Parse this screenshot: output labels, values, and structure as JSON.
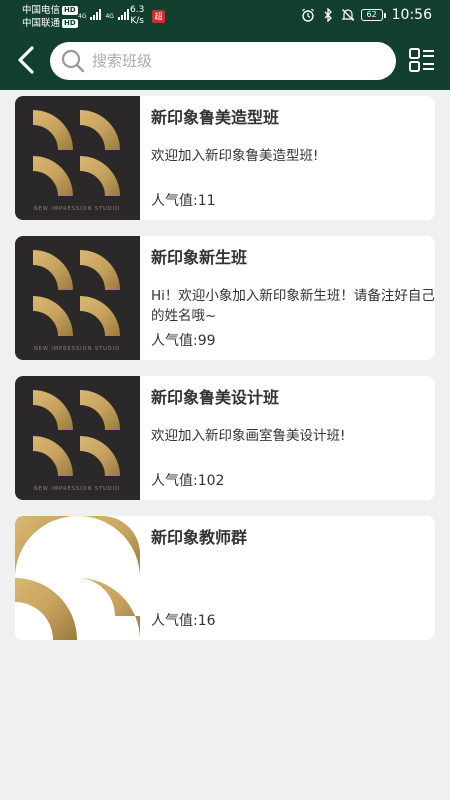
{
  "status_bar": {
    "carrier1": "中国电信",
    "carrier2": "中国联通",
    "hd": "HD",
    "net_tag": "4G",
    "speed_value": "6.3",
    "speed_unit": "K/s",
    "app_badge": "超",
    "battery": "62",
    "time": "10:56"
  },
  "header": {
    "search_placeholder": "搜索班级"
  },
  "popularity_prefix": "人气值:",
  "classes": [
    {
      "title": "新印象鲁美造型班",
      "description": "欢迎加入新印象鲁美造型班!",
      "popularity": "人气值:11",
      "thumb_style": "dark",
      "studio_caption": "NEW IMPRESSION STUDIO"
    },
    {
      "title": "新印象新生班",
      "description": "Hi！欢迎小象加入新印象新生班！请备注好自己的姓名哦~",
      "popularity": "人气值:99",
      "thumb_style": "dark",
      "studio_caption": "NEW IMPRESSION STUDIO"
    },
    {
      "title": "新印象鲁美设计班",
      "description": "欢迎加入新印象画室鲁美设计班!",
      "popularity": "人气值:102",
      "thumb_style": "dark",
      "studio_caption": "NEW IMPRESSION STUDIO"
    },
    {
      "title": "新印象教师群",
      "description": "",
      "popularity": "人气值:16",
      "thumb_style": "light",
      "studio_caption": ""
    }
  ],
  "colors": {
    "header": "#13402e",
    "gold": "#c7a35e",
    "dark_thumb": "#2b2829"
  }
}
